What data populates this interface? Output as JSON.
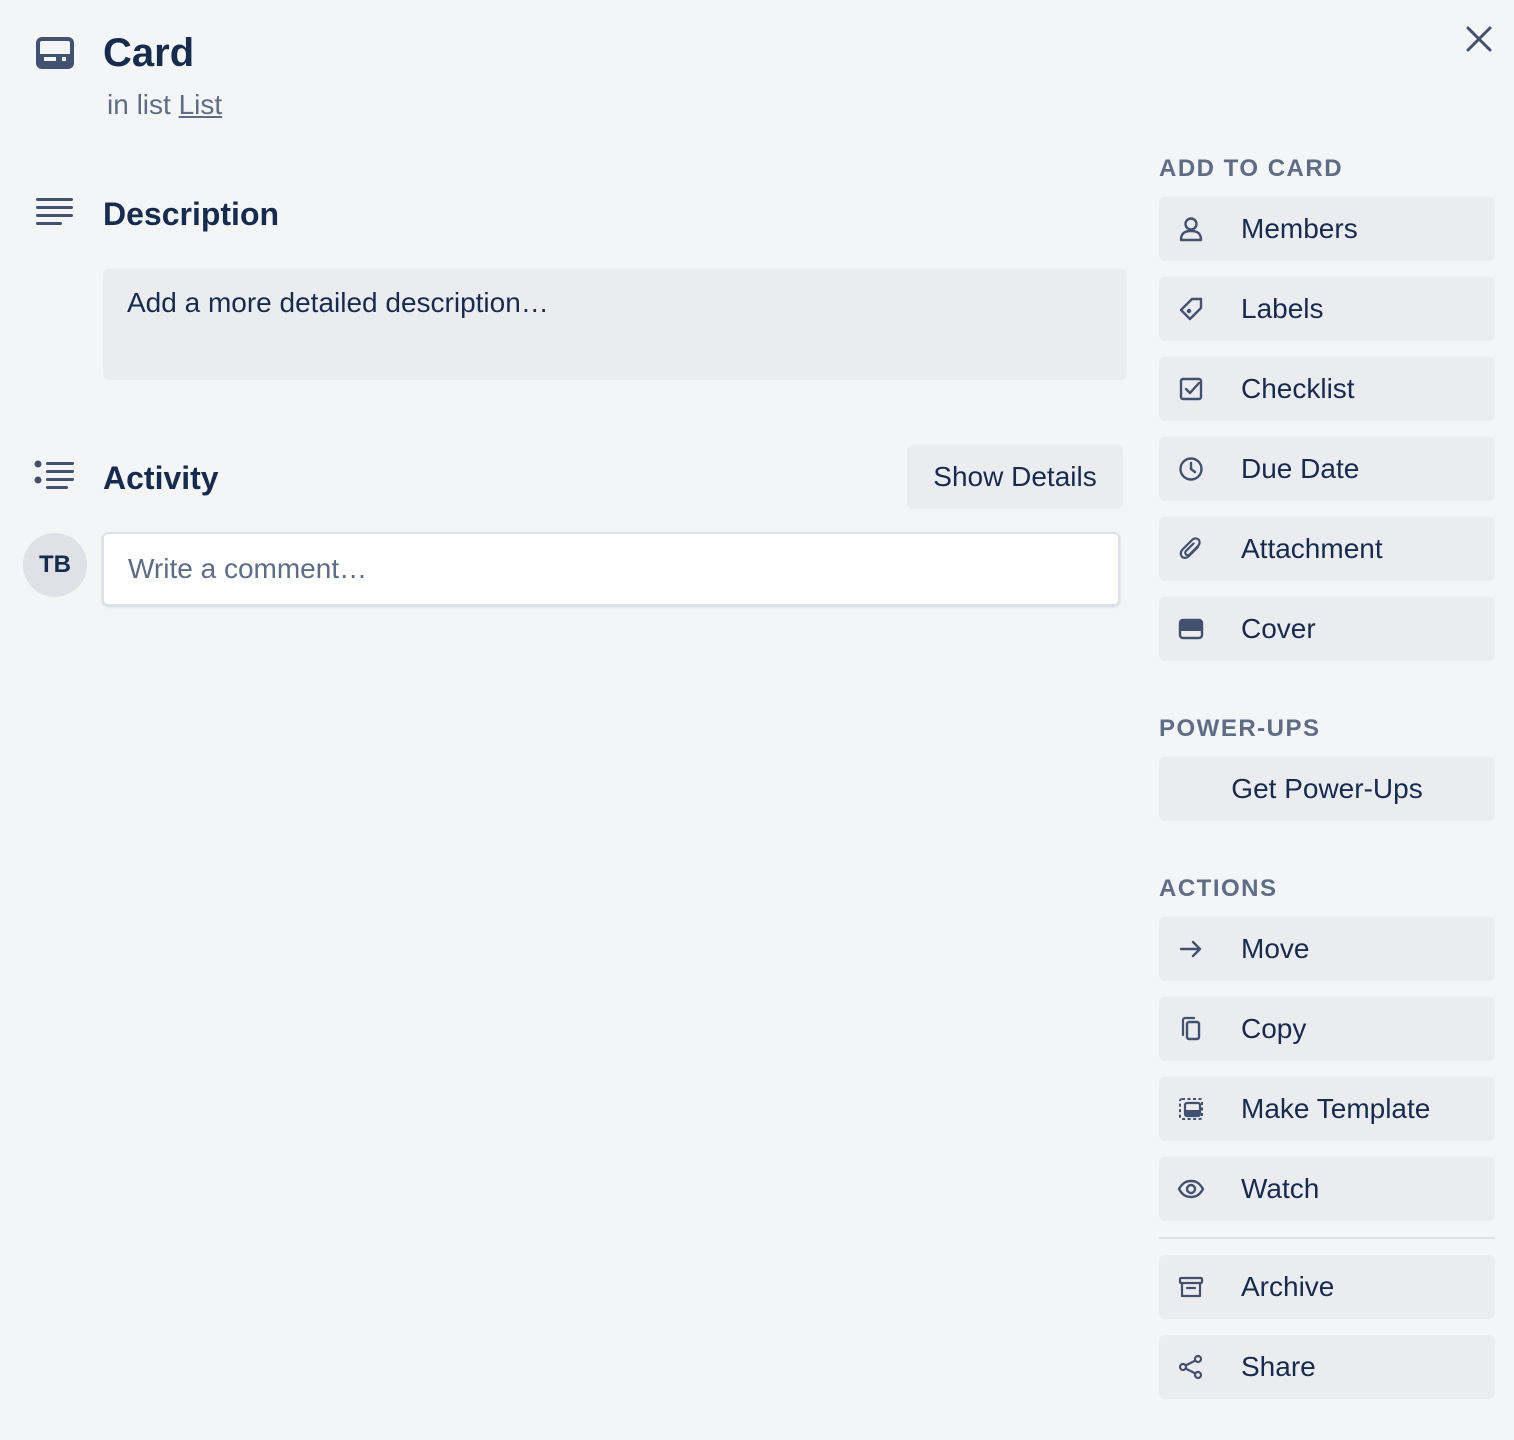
{
  "card": {
    "title": "Card",
    "list_prefix": "in list",
    "list_name": "List"
  },
  "description": {
    "heading": "Description",
    "placeholder": "Add a more detailed description…"
  },
  "activity": {
    "heading": "Activity",
    "show_details_label": "Show Details",
    "avatar_initials": "TB",
    "comment_placeholder": "Write a comment…"
  },
  "sidebar": {
    "add_to_card": {
      "heading": "ADD TO CARD",
      "items": [
        {
          "label": "Members",
          "icon": "person-icon"
        },
        {
          "label": "Labels",
          "icon": "tag-icon"
        },
        {
          "label": "Checklist",
          "icon": "checkbox-icon"
        },
        {
          "label": "Due Date",
          "icon": "clock-icon"
        },
        {
          "label": "Attachment",
          "icon": "paperclip-icon"
        },
        {
          "label": "Cover",
          "icon": "cover-icon"
        }
      ]
    },
    "power_ups": {
      "heading": "POWER-UPS",
      "button_label": "Get Power-Ups"
    },
    "actions": {
      "heading": "ACTIONS",
      "items": [
        {
          "label": "Move",
          "icon": "arrow-right-icon"
        },
        {
          "label": "Copy",
          "icon": "copy-icon"
        },
        {
          "label": "Make Template",
          "icon": "template-icon"
        },
        {
          "label": "Watch",
          "icon": "eye-icon"
        }
      ],
      "secondary_items": [
        {
          "label": "Archive",
          "icon": "archive-icon"
        },
        {
          "label": "Share",
          "icon": "share-icon"
        }
      ]
    }
  },
  "colors": {
    "background": "#f4f5f7",
    "button_bg": "#ebecf0",
    "text_primary": "#172b4d",
    "text_muted": "#5e6c84",
    "icon": "#42526e"
  }
}
